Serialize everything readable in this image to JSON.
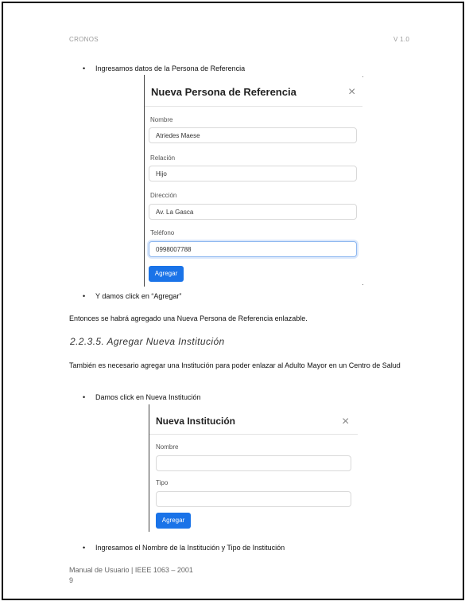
{
  "header": {
    "left": "CRONOS",
    "right": "V 1.0"
  },
  "bullets": {
    "b1": "Ingresamos datos de la Persona de Referencia",
    "b2": "Y damos click en “Agregar”",
    "b3": "Damos click en Nueva Institución",
    "b4": "Ingresamos el Nombre de la Institución y Tipo de Institución",
    "dot": "•"
  },
  "paragraphs": {
    "p1": "Entonces se habrá agregado una Nueva Persona de Referencia enlazable.",
    "p2": "También es necesario agregar una Institución para poder enlazar al Adulto Mayor en un Centro de Salud"
  },
  "section_heading": "2.2.3.5.  Agregar Nueva Institución",
  "modal_referencia": {
    "title": "Nueva Persona de Referencia",
    "close": "×",
    "fields": [
      {
        "label": "Nombre",
        "value": "Atriedes Maese"
      },
      {
        "label": "Relación",
        "value": "Hijo"
      },
      {
        "label": "Dirección",
        "value": "Av. La Gasca"
      },
      {
        "label": "Teléfono",
        "value": "0998007788"
      }
    ],
    "button": "Agregar"
  },
  "modal_institucion": {
    "title": "Nueva Institución",
    "close": "×",
    "fields": [
      {
        "label": "Nombre",
        "value": ""
      },
      {
        "label": "Tipo",
        "value": ""
      }
    ],
    "button": "Agregar"
  },
  "footer": {
    "text": "Manual de Usuario | IEEE 1063 – 2001",
    "page": "9"
  }
}
